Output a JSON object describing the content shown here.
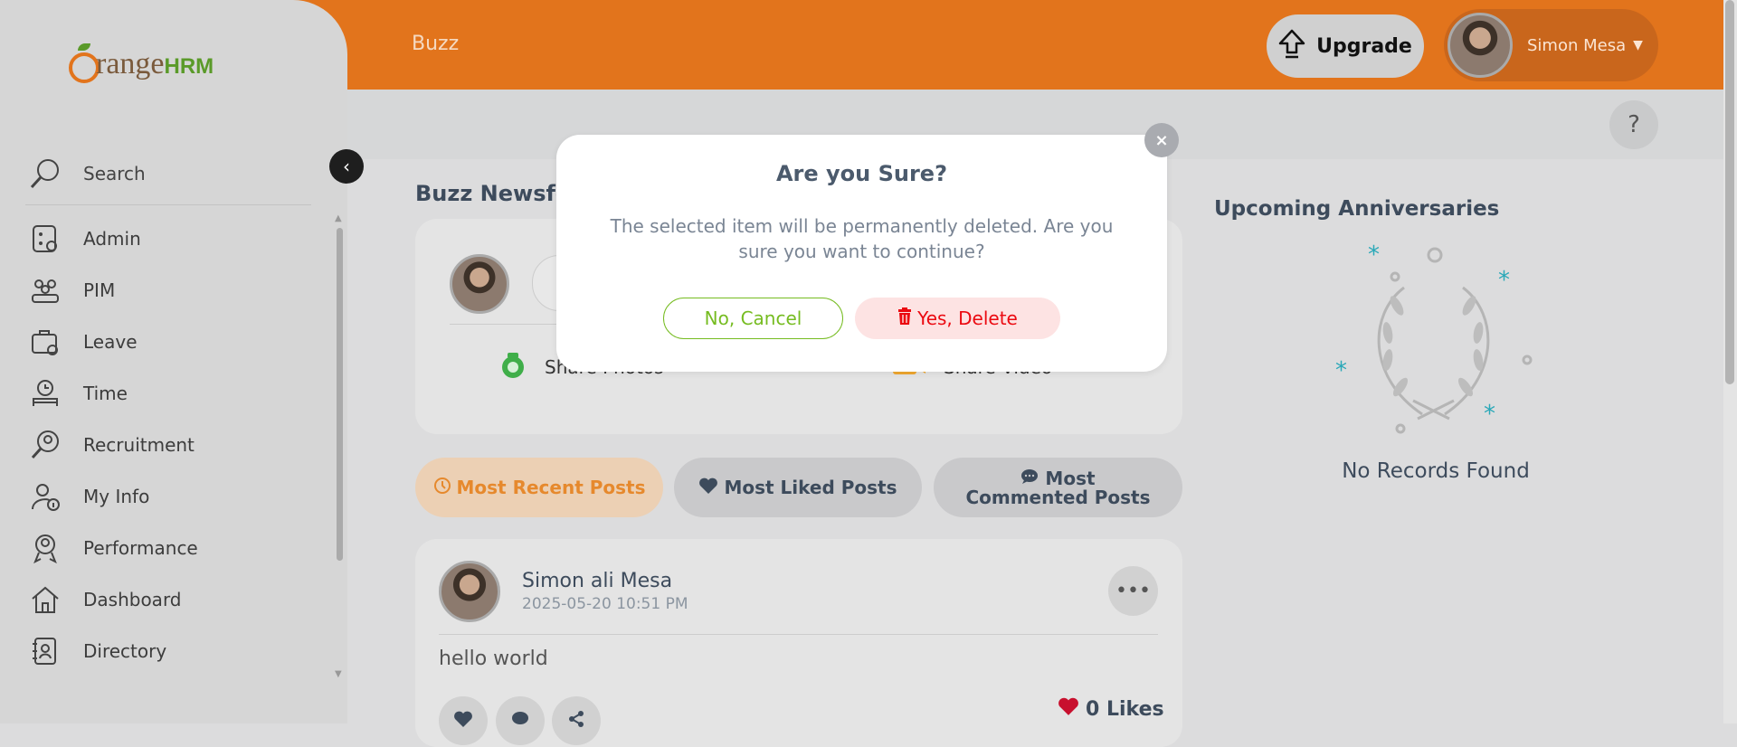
{
  "topbar": {
    "title": "Buzz",
    "upgrade_label": "Upgrade",
    "user_name": "Simon Mesa"
  },
  "help_label": "?",
  "sidebar": {
    "logo_text": "range",
    "logo_suffix": "HRM",
    "search_label": "Search",
    "items": [
      {
        "label": "Admin",
        "icon": "admin-icon"
      },
      {
        "label": "PIM",
        "icon": "pim-icon"
      },
      {
        "label": "Leave",
        "icon": "leave-icon"
      },
      {
        "label": "Time",
        "icon": "time-icon"
      },
      {
        "label": "Recruitment",
        "icon": "recruitment-icon"
      },
      {
        "label": "My Info",
        "icon": "my-info-icon"
      },
      {
        "label": "Performance",
        "icon": "performance-icon"
      },
      {
        "label": "Dashboard",
        "icon": "dashboard-icon"
      },
      {
        "label": "Directory",
        "icon": "directory-icon"
      }
    ]
  },
  "feed": {
    "title": "Buzz Newsfeed",
    "share_photos": "Share Photos",
    "share_video": "Share Video",
    "tabs": {
      "recent": "Most Recent Posts",
      "liked": "Most Liked Posts",
      "commented": "Most Commented Posts"
    }
  },
  "post": {
    "author": "Simon ali Mesa",
    "time": "2025-05-20 10:51 PM",
    "text": "hello world",
    "likes": "0 Likes"
  },
  "anniversaries": {
    "title": "Upcoming Anniversaries",
    "empty": "No Records Found"
  },
  "modal": {
    "title": "Are you Sure?",
    "message": "The selected item will be permanently deleted. Are you sure you want to continue?",
    "cancel_label": "No, Cancel",
    "delete_label": "Yes, Delete",
    "close_label": "×"
  },
  "colors": {
    "brand": "#e2741c",
    "green": "#76bc21",
    "danger": "#eb0910"
  }
}
